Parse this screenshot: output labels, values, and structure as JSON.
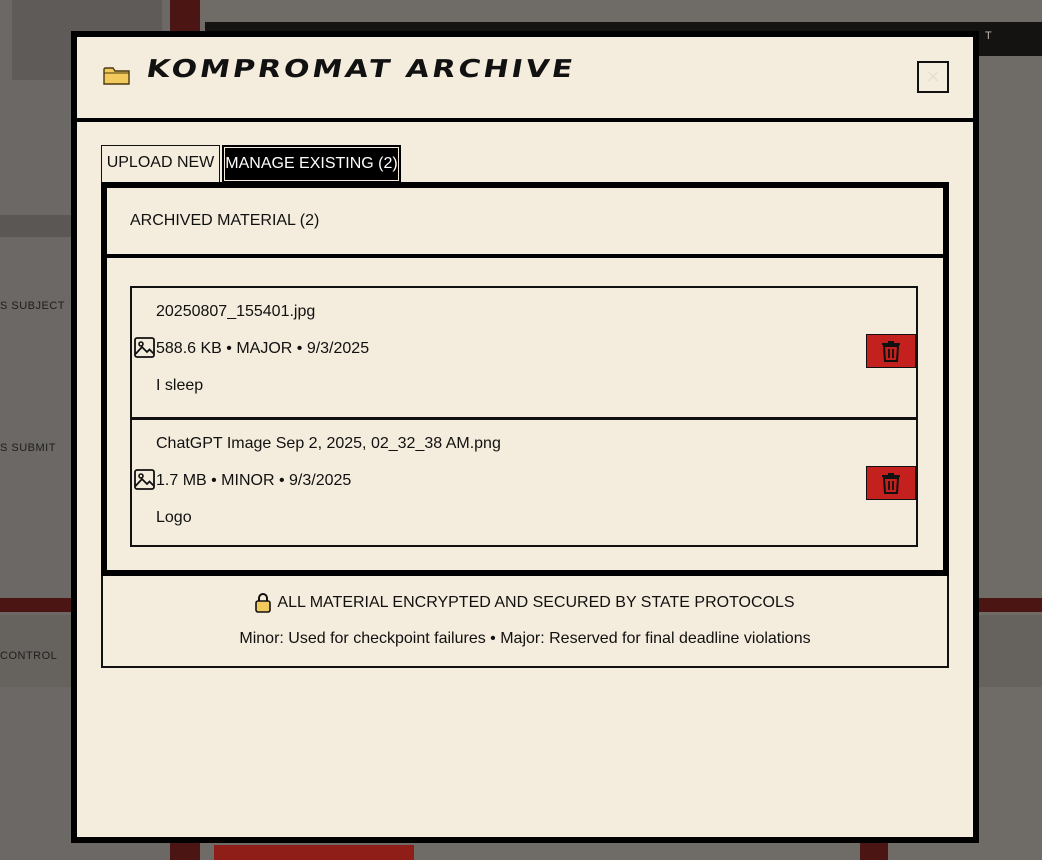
{
  "modal": {
    "title": "KOMPROMAT ARCHIVE",
    "close_label": "×"
  },
  "tabs": [
    {
      "label": "UPLOAD NEW",
      "active": false
    },
    {
      "label": "MANAGE EXISTING (2)",
      "active": true
    }
  ],
  "panel": {
    "title": "ARCHIVED MATERIAL (2)",
    "items": [
      {
        "filename": "20250807_155401.jpg",
        "meta": "588.6 KB • MAJOR • 9/3/2025",
        "description": "I sleep"
      },
      {
        "filename": "ChatGPT Image Sep 2, 2025, 02_32_38 AM.png",
        "meta": "1.7 MB • MINOR • 9/3/2025",
        "description": "Logo"
      }
    ]
  },
  "footer": {
    "secure_text": "ALL MATERIAL ENCRYPTED AND SECURED BY STATE PROTOCOLS",
    "legend": "Minor: Used for checkpoint failures • Major: Reserved for final deadline violations"
  },
  "colors": {
    "modal_bg": "#f4ecdc",
    "border": "#000000",
    "delete_red": "#c4201d",
    "icon_yellow": "#f2c95c"
  }
}
